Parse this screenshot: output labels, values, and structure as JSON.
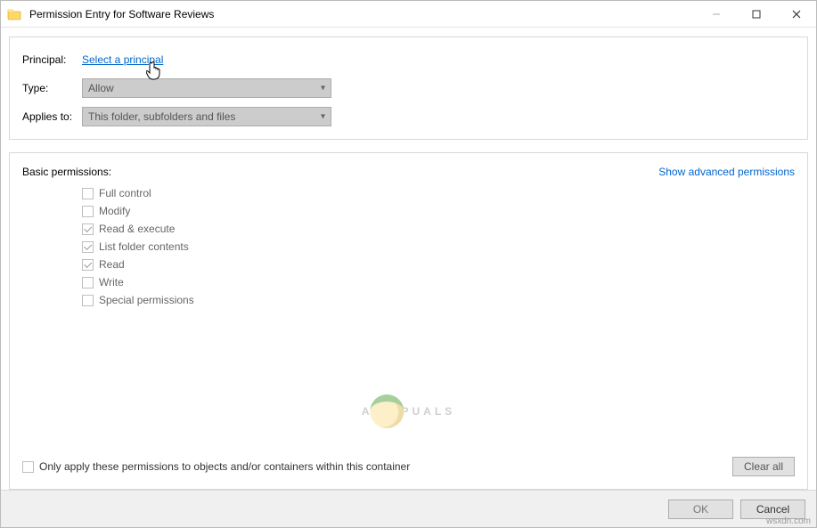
{
  "titlebar": {
    "title": "Permission Entry for Software Reviews"
  },
  "principal": {
    "label": "Principal:",
    "link": "Select a principal"
  },
  "type": {
    "label": "Type:",
    "value": "Allow"
  },
  "applies": {
    "label": "Applies to:",
    "value": "This folder, subfolders and files"
  },
  "permissions": {
    "heading": "Basic permissions:",
    "advanced_link": "Show advanced permissions",
    "items": [
      {
        "label": "Full control",
        "checked": false
      },
      {
        "label": "Modify",
        "checked": false
      },
      {
        "label": "Read & execute",
        "checked": true
      },
      {
        "label": "List folder contents",
        "checked": true
      },
      {
        "label": "Read",
        "checked": true
      },
      {
        "label": "Write",
        "checked": false
      },
      {
        "label": "Special permissions",
        "checked": false
      }
    ]
  },
  "only_apply": {
    "label": "Only apply these permissions to objects and/or containers within this container",
    "checked": false
  },
  "buttons": {
    "clear_all": "Clear all",
    "ok": "OK",
    "cancel": "Cancel"
  },
  "watermark": {
    "pre": "A",
    "post": "PUALS"
  },
  "footer_note": "wsxdn.com"
}
